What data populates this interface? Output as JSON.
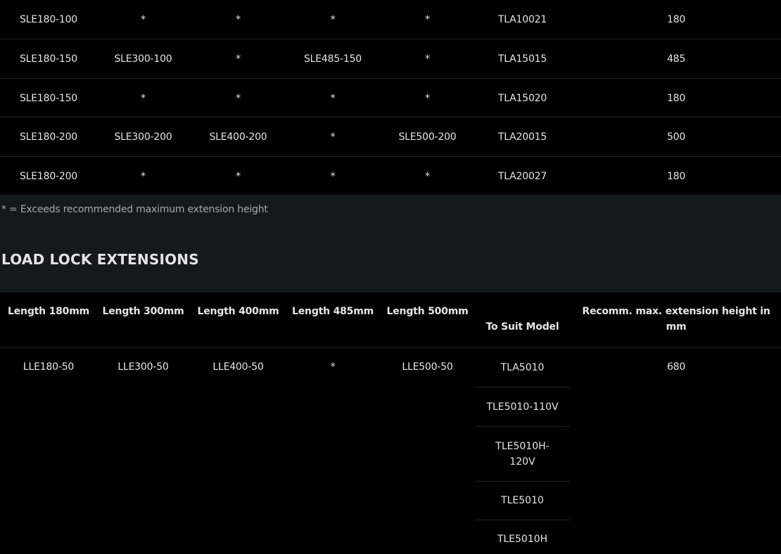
{
  "top_table": {
    "rows": [
      {
        "cells": [
          "SLE180-100",
          "*",
          "*",
          "*",
          "*",
          "TLA10021",
          "180"
        ]
      },
      {
        "cells": [
          "SLE180-150",
          "SLE300-100",
          "*",
          "SLE485-150",
          "*",
          "TLA15015",
          "485"
        ]
      },
      {
        "cells": [
          "SLE180-150",
          "*",
          "*",
          "*",
          "*",
          "TLA15020",
          "180"
        ]
      },
      {
        "cells": [
          "SLE180-200",
          "SLE300-200",
          "SLE400-200",
          "*",
          "SLE500-200",
          "TLA20015",
          "500"
        ]
      },
      {
        "cells": [
          "SLE180-200",
          "*",
          "*",
          "*",
          "*",
          "TLA20027",
          "180"
        ]
      }
    ]
  },
  "footnote": "* = Exceeds recommended maximum extension height",
  "section_title": "LOAD LOCK EXTENSIONS",
  "load_lock_table": {
    "headers": [
      "Length 180mm",
      "Length 300mm",
      "Length 400mm",
      "Length 485mm",
      "Length 500mm",
      "To Suit Model",
      "Recomm. max. extension height in mm"
    ],
    "row": {
      "cells": [
        "LLE180-50",
        "LLE300-50",
        "LLE400-50",
        "*",
        "LLE500-50"
      ],
      "models": [
        "TLA5010",
        "TLE5010-110V",
        "TLE5010H-120V",
        "TLE5010",
        "TLE5010H"
      ],
      "max_height": "680"
    }
  }
}
